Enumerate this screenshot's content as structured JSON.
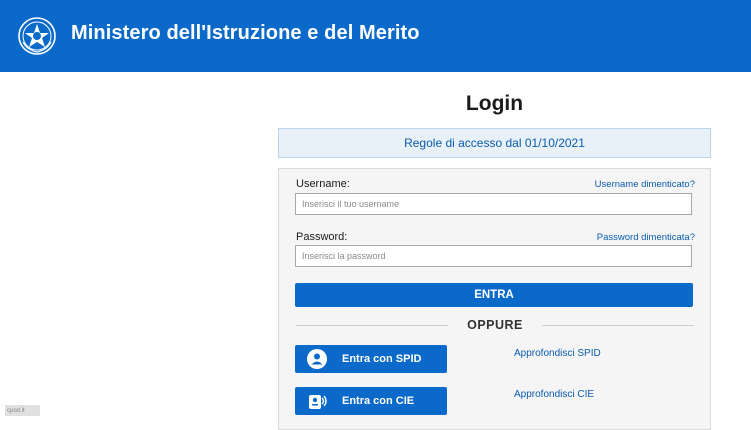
{
  "header": {
    "title": "Ministero dell'Istruzione e del Merito",
    "emblem_icon": "republic-emblem-icon",
    "background_color": "#0b6ac9"
  },
  "login": {
    "title": "Login",
    "rules_link": "Regole di accesso dal 01/10/2021",
    "username_label": "Username:",
    "username_forgot": "Username dimenticato?",
    "username_placeholder": "Inserisci il tuo username",
    "username_value": "",
    "password_label": "Password:",
    "password_forgot": "Password dimenticata?",
    "password_placeholder": "Inserisci la password",
    "password_value": "",
    "submit_label": "ENTRA",
    "divider_label": "OPPURE"
  },
  "alt_auth": {
    "spid": {
      "label": "Entra con SPID",
      "info_link": "Approfondisci SPID",
      "icon": "user-icon"
    },
    "cie": {
      "label": "Entra con CIE",
      "info_link": "Approfondisci CIE",
      "icon": "id-card-icon"
    }
  },
  "corner_badge": {
    "text": "cpod.it"
  },
  "colors": {
    "primary": "#0b6ac9",
    "link": "#0b5cad",
    "panel": "#f5f5f5"
  }
}
